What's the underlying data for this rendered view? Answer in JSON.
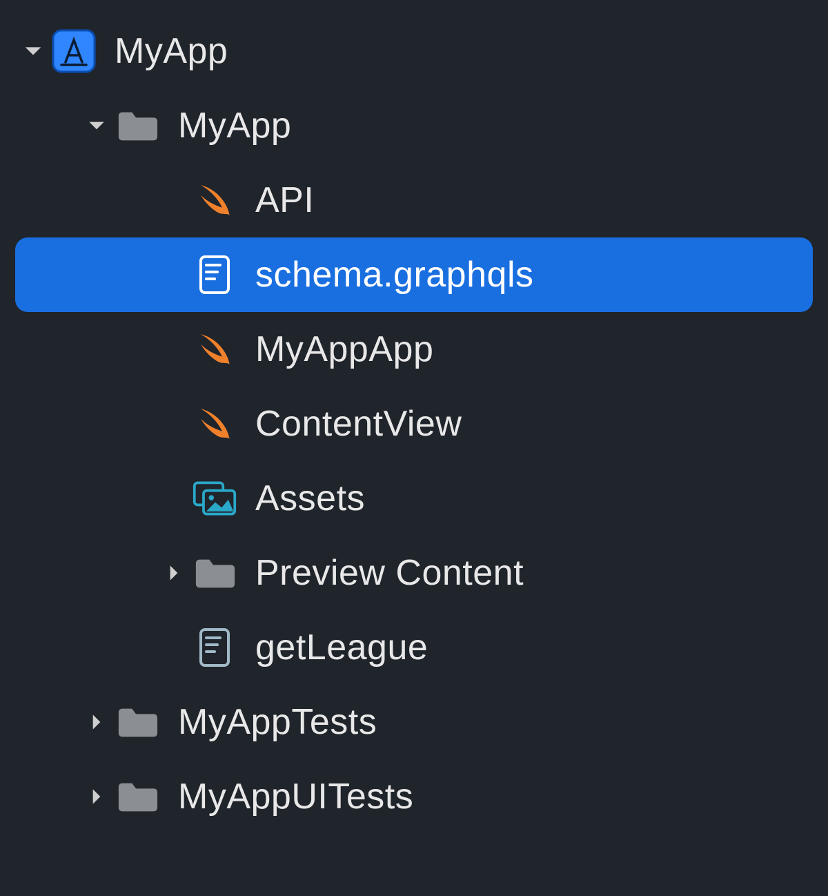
{
  "tree": {
    "root": {
      "label": "MyApp",
      "folder1": {
        "label": "MyApp",
        "items": [
          {
            "label": "API"
          },
          {
            "label": "schema.graphqls"
          },
          {
            "label": "MyAppApp"
          },
          {
            "label": "ContentView"
          },
          {
            "label": "Assets"
          },
          {
            "label": "Preview Content"
          },
          {
            "label": "getLeague"
          }
        ]
      },
      "folder2": {
        "label": "MyAppTests"
      },
      "folder3": {
        "label": "MyAppUITests"
      }
    }
  }
}
